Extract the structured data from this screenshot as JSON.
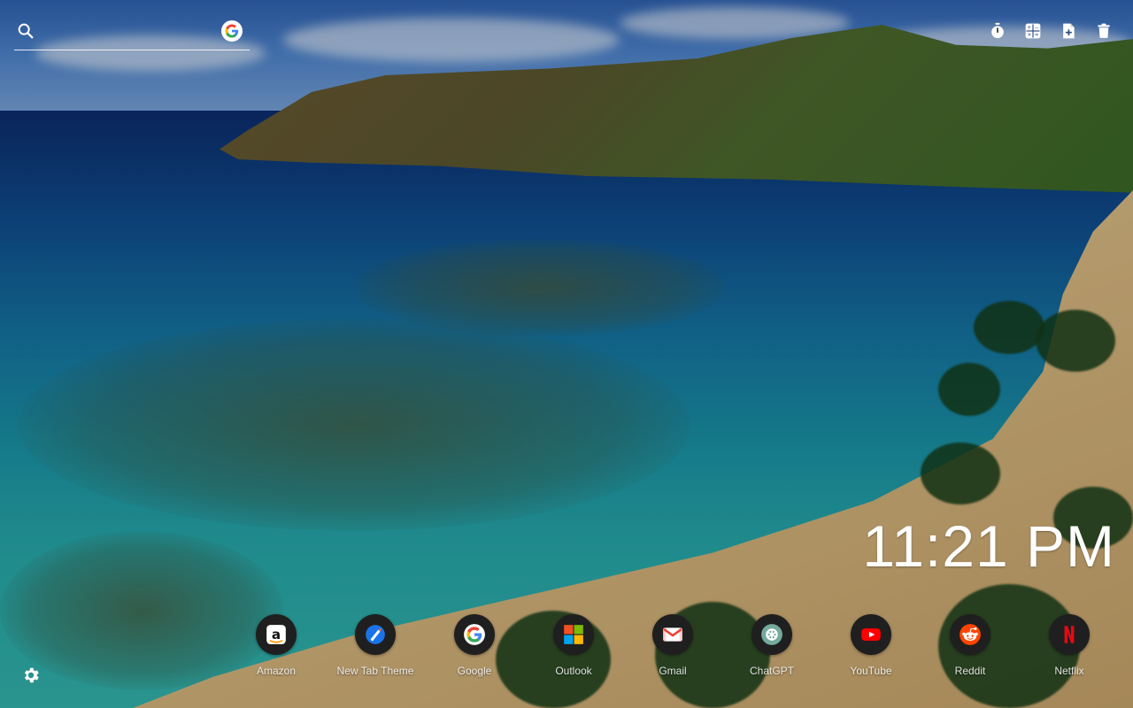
{
  "search": {
    "placeholder": "",
    "icon": "search-icon",
    "engine_icon": "google-logo-icon"
  },
  "toolbar": {
    "items": [
      {
        "icon": "timer-icon"
      },
      {
        "icon": "calculator-icon"
      },
      {
        "icon": "new-note-icon"
      },
      {
        "icon": "trash-icon"
      }
    ]
  },
  "clock": {
    "time": "11:21 PM"
  },
  "shortcuts": [
    {
      "label": "Amazon",
      "icon": "amazon-icon"
    },
    {
      "label": "New Tab Theme",
      "icon": "new-tab-theme-icon"
    },
    {
      "label": "Google",
      "icon": "google-icon"
    },
    {
      "label": "Outlook",
      "icon": "outlook-icon"
    },
    {
      "label": "Gmail",
      "icon": "gmail-icon"
    },
    {
      "label": "ChatGPT",
      "icon": "chatgpt-icon"
    },
    {
      "label": "YouTube",
      "icon": "youtube-icon"
    },
    {
      "label": "Reddit",
      "icon": "reddit-icon"
    },
    {
      "label": "Netflix",
      "icon": "netflix-icon"
    }
  ],
  "settings": {
    "icon": "gear-icon"
  },
  "colors": {
    "google_blue": "#4285F4",
    "google_red": "#EA4335",
    "google_yellow": "#FBBC05",
    "google_green": "#34A853",
    "youtube_red": "#FF0000",
    "reddit_orange": "#FF4500",
    "netflix_red": "#E50914",
    "chatgpt_teal": "#74AA9C"
  }
}
